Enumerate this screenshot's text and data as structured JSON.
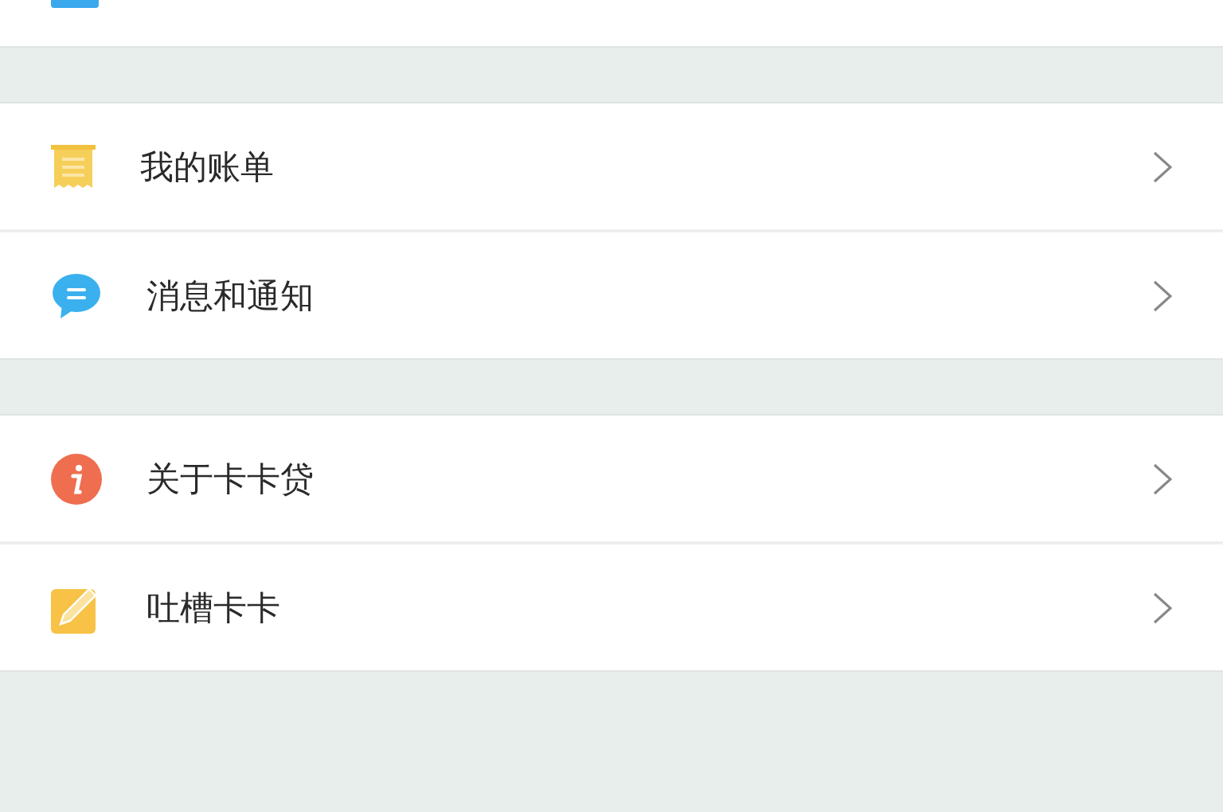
{
  "sections": [
    {
      "items": [
        {
          "label": "我的账单",
          "kind": "bill"
        },
        {
          "label": "消息和通知",
          "kind": "message"
        }
      ]
    },
    {
      "items": [
        {
          "label": "关于卡卡贷",
          "kind": "info"
        },
        {
          "label": "吐槽卡卡",
          "kind": "edit"
        }
      ]
    }
  ]
}
